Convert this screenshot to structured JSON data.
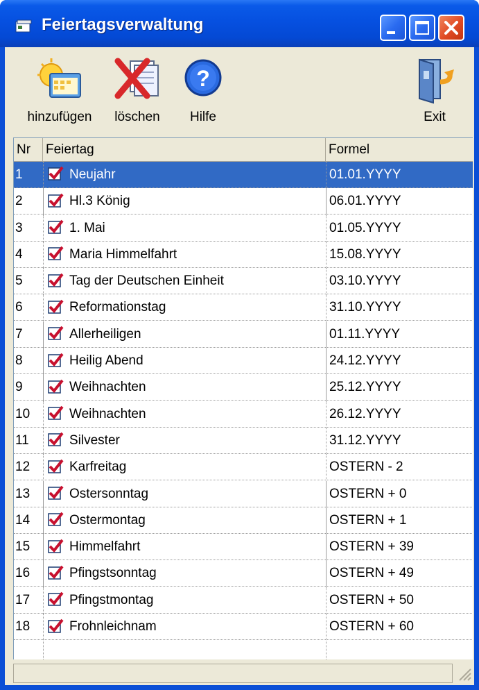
{
  "window": {
    "title": "Feiertagsverwaltung",
    "buttons": {
      "minimize": "minimize",
      "maximize": "maximize",
      "close": "close"
    }
  },
  "toolbar": {
    "add_label": "hinzufügen",
    "delete_label": "löschen",
    "help_label": "Hilfe",
    "exit_label": "Exit"
  },
  "table": {
    "columns": [
      "Nr",
      "Feiertag",
      "Formel"
    ],
    "selected_row": 1,
    "rows": [
      {
        "nr": "1",
        "name": "Neujahr",
        "formula": "01.01.YYYY",
        "checked": true
      },
      {
        "nr": "2",
        "name": "Hl.3 König",
        "formula": "06.01.YYYY",
        "checked": true
      },
      {
        "nr": "3",
        "name": "1. Mai",
        "formula": "01.05.YYYY",
        "checked": true
      },
      {
        "nr": "4",
        "name": "Maria Himmelfahrt",
        "formula": "15.08.YYYY",
        "checked": true
      },
      {
        "nr": "5",
        "name": "Tag der Deutschen Einheit",
        "formula": "03.10.YYYY",
        "checked": true
      },
      {
        "nr": "6",
        "name": "Reformationstag",
        "formula": "31.10.YYYY",
        "checked": true
      },
      {
        "nr": "7",
        "name": "Allerheiligen",
        "formula": "01.11.YYYY",
        "checked": true
      },
      {
        "nr": "8",
        "name": "Heilig Abend",
        "formula": "24.12.YYYY",
        "checked": true
      },
      {
        "nr": "9",
        "name": "Weihnachten",
        "formula": "25.12.YYYY",
        "checked": true
      },
      {
        "nr": "10",
        "name": "Weihnachten",
        "formula": "26.12.YYYY",
        "checked": true
      },
      {
        "nr": "11",
        "name": "Silvester",
        "formula": "31.12.YYYY",
        "checked": true
      },
      {
        "nr": "12",
        "name": "Karfreitag",
        "formula": "OSTERN - 2",
        "checked": true
      },
      {
        "nr": "13",
        "name": "Ostersonntag",
        "formula": "OSTERN + 0",
        "checked": true
      },
      {
        "nr": "14",
        "name": "Ostermontag",
        "formula": "OSTERN + 1",
        "checked": true
      },
      {
        "nr": "15",
        "name": "Himmelfahrt",
        "formula": "OSTERN + 39",
        "checked": true
      },
      {
        "nr": "16",
        "name": "Pfingstsonntag",
        "formula": "OSTERN + 49",
        "checked": true
      },
      {
        "nr": "17",
        "name": "Pfingstmontag",
        "formula": "OSTERN + 50",
        "checked": true
      },
      {
        "nr": "18",
        "name": "Frohnleichnam",
        "formula": "OSTERN + 60",
        "checked": true
      }
    ]
  },
  "colors": {
    "title_blue": "#0650e0",
    "selection": "#316ac5",
    "face": "#ece9d8",
    "check_red": "#c8102e"
  }
}
